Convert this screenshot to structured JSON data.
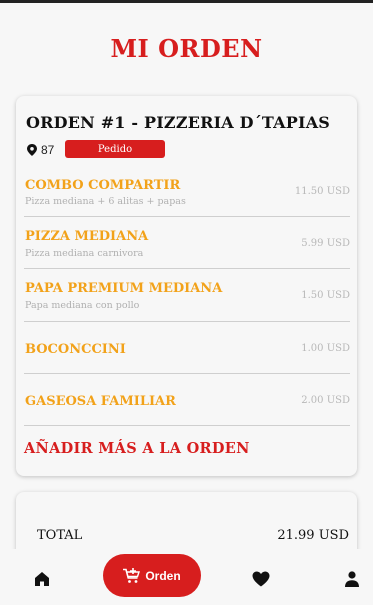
{
  "header": {
    "title": "MI ORDEN"
  },
  "order": {
    "title": "ORDEN #1 - PIZZERIA D´TAPIAS",
    "location_number": "87",
    "status": "Pedido",
    "items": [
      {
        "name": "COMBO COMPARTIR",
        "description": "Pizza mediana + 6 alitas + papas",
        "price": "11.50 USD"
      },
      {
        "name": "PIZZA MEDIANA",
        "description": "Pizza mediana carnivora",
        "price": "5.99 USD"
      },
      {
        "name": "PAPA PREMIUM MEDIANA",
        "description": "Papa mediana con pollo",
        "price": "1.50 USD"
      },
      {
        "name": "BOCONCCINI",
        "description": "",
        "price": "1.00 USD"
      },
      {
        "name": "GASEOSA FAMILIAR",
        "description": "",
        "price": "2.00 USD"
      }
    ],
    "add_more_label": "AÑADIR MÁS A LA ORDEN"
  },
  "summary": {
    "total_label": "TOTAL",
    "total_value": "21.99 USD"
  },
  "bottom_nav": {
    "home_icon": "home-icon",
    "orden_label": "Orden",
    "orden_icon": "cart-plus-icon",
    "favorites_icon": "heart-icon",
    "profile_icon": "user-icon"
  },
  "colors": {
    "accent": "#d71e1e",
    "item_name": "#f2a21a",
    "muted": "#b0b0b0"
  }
}
